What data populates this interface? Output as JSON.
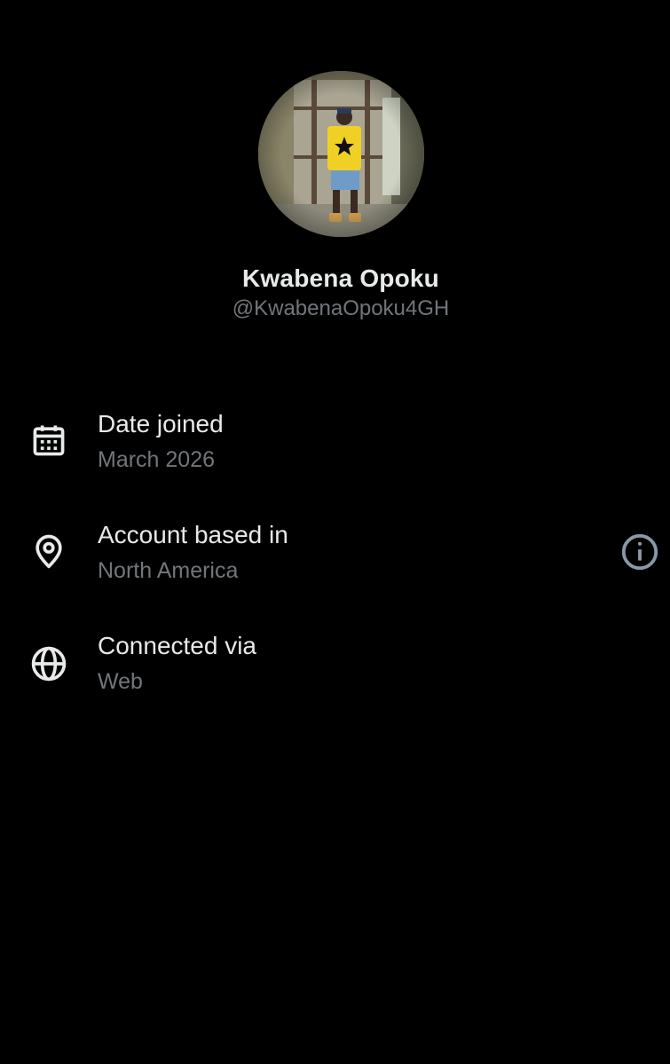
{
  "profile": {
    "display_name": "Kwabena Opoku",
    "handle": "@KwabenaOpoku4GH",
    "avatar_icon": "profile-photo"
  },
  "about": {
    "rows": [
      {
        "title": "Date joined",
        "value": "March 2026",
        "icon": "calendar-icon"
      },
      {
        "title": "Account based in",
        "value": "North America",
        "icon": "location-pin-icon",
        "trailing_icon": "info-icon"
      },
      {
        "title": "Connected via",
        "value": "Web",
        "icon": "globe-icon"
      }
    ]
  },
  "colors": {
    "background": "#000000",
    "primary_text": "#e7e9ea",
    "secondary_text": "#71767b"
  }
}
